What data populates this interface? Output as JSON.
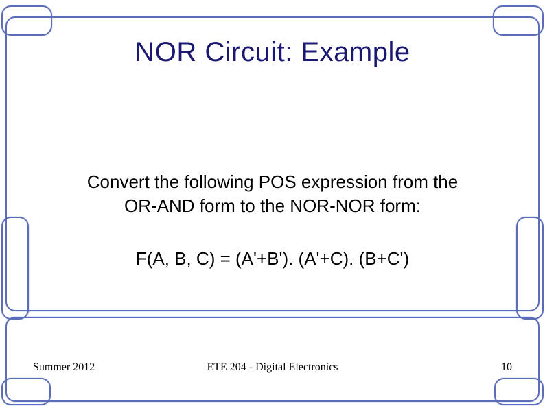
{
  "title": "NOR Circuit:  Example",
  "body_line1": "Convert the following POS expression from the",
  "body_line2": "OR-AND form to the NOR-NOR form:",
  "equation": "F(A, B, C) = (A'+B'). (A'+C). (B+C')",
  "footer": {
    "left": "Summer 2012",
    "center": "ETE 204 - Digital Electronics",
    "right": "10"
  }
}
